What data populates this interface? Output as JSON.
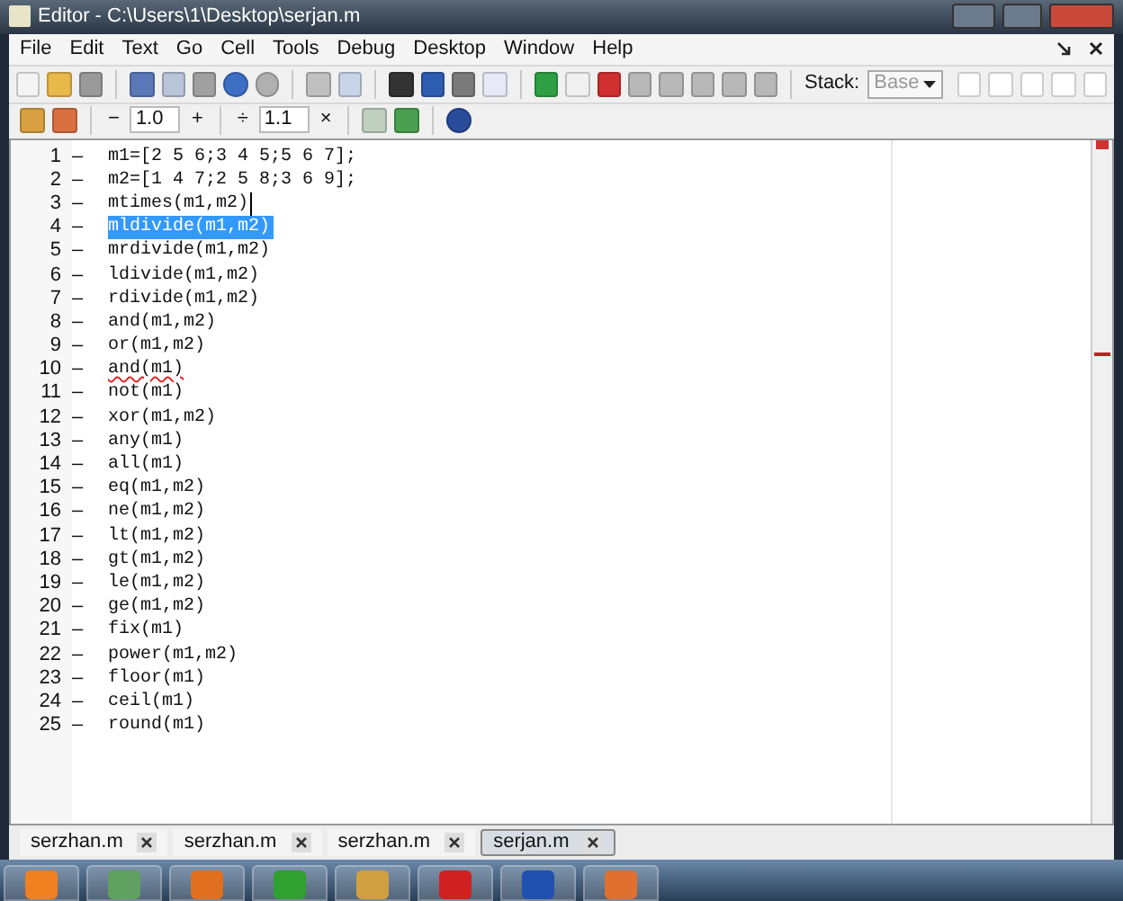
{
  "window": {
    "title": "Editor - C:\\Users\\1\\Desktop\\serjan.m"
  },
  "menu": [
    "File",
    "Edit",
    "Text",
    "Go",
    "Cell",
    "Tools",
    "Debug",
    "Desktop",
    "Window",
    "Help"
  ],
  "toolbar": {
    "stack_label": "Stack:",
    "stack_value": "Base"
  },
  "cell_toolbar": {
    "minus": "−",
    "first_value": "1.0",
    "plus": "+",
    "divide": "÷",
    "second_value": "1.1",
    "times": "×"
  },
  "lines": [
    {
      "number": "1",
      "marker": "–",
      "code": "m1=[2 5 6;3 4 5;5 6 7];",
      "selected": false,
      "cursor": false,
      "warning": false
    },
    {
      "number": "2",
      "marker": "–",
      "code": "m2=[1 4 7;2 5 8;3 6 9];",
      "selected": false,
      "cursor": false,
      "warning": false
    },
    {
      "number": "3",
      "marker": "–",
      "code": "mtimes(m1,m2)",
      "selected": false,
      "cursor": true,
      "warning": false
    },
    {
      "number": "4",
      "marker": "–",
      "code": "mldivide(m1,m2)",
      "selected": true,
      "cursor": false,
      "warning": false
    },
    {
      "number": "5",
      "marker": "–",
      "code": "mrdivide(m1,m2)",
      "selected": false,
      "cursor": false,
      "warning": false
    },
    {
      "number": "6",
      "marker": "–",
      "code": "ldivide(m1,m2)",
      "selected": false,
      "cursor": false,
      "warning": false
    },
    {
      "number": "7",
      "marker": "–",
      "code": "rdivide(m1,m2)",
      "selected": false,
      "cursor": false,
      "warning": false
    },
    {
      "number": "8",
      "marker": "–",
      "code": "and(m1,m2)",
      "selected": false,
      "cursor": false,
      "warning": false
    },
    {
      "number": "9",
      "marker": "–",
      "code": "or(m1,m2)",
      "selected": false,
      "cursor": false,
      "warning": false
    },
    {
      "number": "10",
      "marker": "–",
      "code": "and(m1)",
      "selected": false,
      "cursor": false,
      "warning": true
    },
    {
      "number": "11",
      "marker": "–",
      "code": "not(m1)",
      "selected": false,
      "cursor": false,
      "warning": false
    },
    {
      "number": "12",
      "marker": "–",
      "code": "xor(m1,m2)",
      "selected": false,
      "cursor": false,
      "warning": false
    },
    {
      "number": "13",
      "marker": "–",
      "code": "any(m1)",
      "selected": false,
      "cursor": false,
      "warning": false
    },
    {
      "number": "14",
      "marker": "–",
      "code": "all(m1)",
      "selected": false,
      "cursor": false,
      "warning": false
    },
    {
      "number": "15",
      "marker": "–",
      "code": "eq(m1,m2)",
      "selected": false,
      "cursor": false,
      "warning": false
    },
    {
      "number": "16",
      "marker": "–",
      "code": "ne(m1,m2)",
      "selected": false,
      "cursor": false,
      "warning": false
    },
    {
      "number": "17",
      "marker": "–",
      "code": "lt(m1,m2)",
      "selected": false,
      "cursor": false,
      "warning": false
    },
    {
      "number": "18",
      "marker": "–",
      "code": "gt(m1,m2)",
      "selected": false,
      "cursor": false,
      "warning": false
    },
    {
      "number": "19",
      "marker": "–",
      "code": "le(m1,m2)",
      "selected": false,
      "cursor": false,
      "warning": false
    },
    {
      "number": "20",
      "marker": "–",
      "code": "ge(m1,m2)",
      "selected": false,
      "cursor": false,
      "warning": false
    },
    {
      "number": "21",
      "marker": "–",
      "code": "fix(m1)",
      "selected": false,
      "cursor": false,
      "warning": false
    },
    {
      "number": "22",
      "marker": "–",
      "code": "power(m1,m2)",
      "selected": false,
      "cursor": false,
      "warning": false
    },
    {
      "number": "23",
      "marker": "–",
      "code": "floor(m1)",
      "selected": false,
      "cursor": false,
      "warning": false
    },
    {
      "number": "24",
      "marker": "–",
      "code": "ceil(m1)",
      "selected": false,
      "cursor": false,
      "warning": false
    },
    {
      "number": "25",
      "marker": "–",
      "code": "round(m1)",
      "selected": false,
      "cursor": false,
      "warning": false
    }
  ],
  "tabs": [
    {
      "label": "serzhan.m",
      "selected": false
    },
    {
      "label": "serzhan.m",
      "selected": false
    },
    {
      "label": "serzhan.m",
      "selected": false
    },
    {
      "label": "serjan.m",
      "selected": true
    }
  ]
}
